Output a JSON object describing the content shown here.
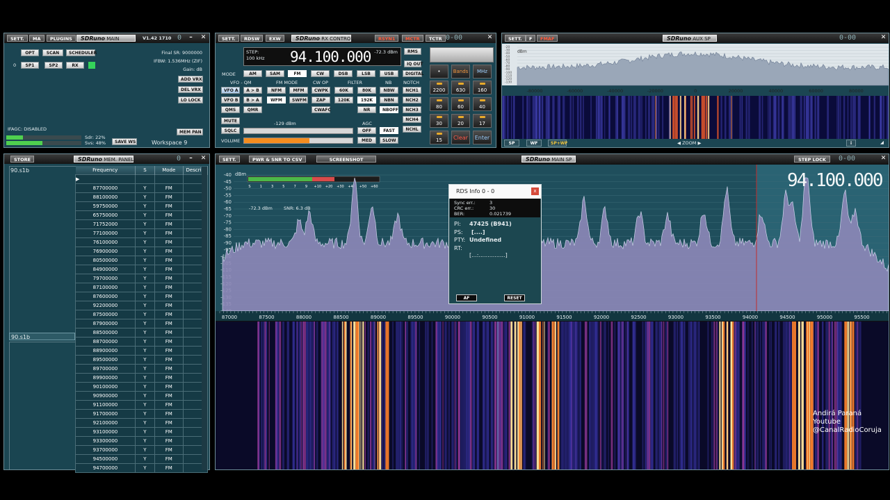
{
  "main_window": {
    "buttons": [
      "SETT.",
      "MA",
      "PLUGINS"
    ],
    "logo": "SDRuno",
    "logo_sub": "MAIN",
    "version": "V1.42 1710",
    "final_sr": "Final SR: 9000000",
    "ifbw": "IFBW: 1.536MHz (ZIF)",
    "gain": "Gain: dB",
    "row1": [
      "OPT",
      "SCAN",
      "SCHEDULER"
    ],
    "row2_index": "0",
    "row2": [
      "SP1",
      "SP2",
      "RX"
    ],
    "side_buttons": [
      "ADD VRX",
      "DEL VRX",
      "LO LOCK"
    ],
    "ifagc": "IFAGC: DISABLED",
    "sdr": "Sdr: 22%",
    "svs": "Svs: 48%",
    "save_ws": "SAVE WS",
    "workspace": "Workspace 9",
    "mem_pan": "MEM PAN",
    "sdr_load": 0.22,
    "svs_load": 0.48
  },
  "rx_control": {
    "buttons_left": [
      "SETT.",
      "RDSW",
      "EXW"
    ],
    "logo": "SDRuno",
    "logo_sub": "RX CONTROL",
    "buttons_right": [
      "RSYN1",
      "MCTR",
      "TCTR"
    ],
    "step_label": "STEP:",
    "step_value": "100 kHz",
    "frequency": "94.100.000",
    "signal_dbm": "-72.3 dBm",
    "rms": "RMS",
    "iq_out": "IQ OUT",
    "digital": "DIGITAL",
    "mode_label": "MODE",
    "modes": [
      "AM",
      "SAM",
      "FM",
      "CW",
      "DSB",
      "LSB",
      "USB"
    ],
    "vfo_label": "VFO - QM",
    "fm_mode_label": "FM MODE",
    "cw_op_label": "CW OP",
    "filter_label": "FILTER",
    "nb_label": "NB",
    "notch_label": "NOTCH",
    "vfo_a": "VFO A",
    "a_to_b": "A > B",
    "vfo_b": "VFO B",
    "b_to_a": "B > A",
    "qms": "QMS",
    "qmr": "QMR",
    "fm_modes": [
      "NFM",
      "MFM",
      "WFM",
      "SWFM"
    ],
    "cw_op": [
      "CWPK",
      "ZAP",
      "CWAFC"
    ],
    "filters": [
      "60K",
      "80K",
      "120K",
      "192K",
      "NR"
    ],
    "nb": [
      "NBW",
      "NBN",
      "NBOFF"
    ],
    "notch": [
      "NCH1",
      "NCH2",
      "NCH3",
      "NCH4",
      "NCHL"
    ],
    "mute": "MUTE",
    "sqlc": "SQLC",
    "volume": "VOLUME",
    "sql_level": "-129 dBm",
    "agc_label": "AGC",
    "agc": [
      "OFF",
      "FAST",
      "MED",
      "SLOW"
    ],
    "volume_level": 0.6,
    "keypad": [
      "•",
      "Bands",
      "MHz",
      "2200",
      "630",
      "160",
      "80",
      "60",
      "40",
      "30",
      "20",
      "17",
      "15",
      "Clear",
      "Enter"
    ]
  },
  "aux_sp": {
    "buttons": [
      "SETT.",
      "F",
      "FMAF"
    ],
    "logo": "SDRuno",
    "logo_sub": "AUX SP",
    "y_labels": [
      "-20",
      "-30",
      "-40",
      "-50",
      "-60",
      "-70",
      "-80",
      "-90",
      "-100",
      "-110",
      "-120",
      "-130"
    ],
    "y_unit": "dBm",
    "x_labels": [
      "-80000",
      "-60000",
      "-40000",
      "-20000",
      "0",
      "20000",
      "40000",
      "60000",
      "80000"
    ],
    "bottom_buttons": [
      "SP",
      "WF",
      "SP+WF"
    ],
    "zoom": "ZOOM",
    "info": "i"
  },
  "memory_panel": {
    "store": "STORE",
    "logo": "SDRuno",
    "logo_sub": "MEM. PANEL",
    "list_item": "90.s1b",
    "list_item_selected": "90.s1b",
    "columns": [
      "Frequency",
      "S",
      "Mode",
      "Descrip"
    ],
    "rows": [
      [
        "87700000",
        "Y",
        "FM"
      ],
      [
        "88100000",
        "Y",
        "FM"
      ],
      [
        "59750000",
        "Y",
        "FM"
      ],
      [
        "65750000",
        "Y",
        "FM"
      ],
      [
        "71752000",
        "Y",
        "FM"
      ],
      [
        "77100000",
        "Y",
        "FM"
      ],
      [
        "76100000",
        "Y",
        "FM"
      ],
      [
        "76900000",
        "Y",
        "FM"
      ],
      [
        "80500000",
        "Y",
        "FM"
      ],
      [
        "84900000",
        "Y",
        "FM"
      ],
      [
        "79700000",
        "Y",
        "FM"
      ],
      [
        "87100000",
        "Y",
        "FM"
      ],
      [
        "87600000",
        "Y",
        "FM"
      ],
      [
        "92200000",
        "Y",
        "FM"
      ],
      [
        "87500000",
        "Y",
        "FM"
      ],
      [
        "87900000",
        "Y",
        "FM"
      ],
      [
        "88500000",
        "Y",
        "FM"
      ],
      [
        "88700000",
        "Y",
        "FM"
      ],
      [
        "88900000",
        "Y",
        "FM"
      ],
      [
        "89500000",
        "Y",
        "FM"
      ],
      [
        "89700000",
        "Y",
        "FM"
      ],
      [
        "89900000",
        "Y",
        "FM"
      ],
      [
        "90100000",
        "Y",
        "FM"
      ],
      [
        "90900000",
        "Y",
        "FM"
      ],
      [
        "91100000",
        "Y",
        "FM"
      ],
      [
        "91700000",
        "Y",
        "FM"
      ],
      [
        "92100000",
        "Y",
        "FM"
      ],
      [
        "93100000",
        "Y",
        "FM"
      ],
      [
        "93300000",
        "Y",
        "FM"
      ],
      [
        "93700000",
        "Y",
        "FM"
      ],
      [
        "94500000",
        "Y",
        "FM"
      ],
      [
        "94700000",
        "Y",
        "FM"
      ]
    ]
  },
  "main_sp": {
    "buttons": [
      "SETT.",
      "PWR & SNR TO CSV",
      "SCREENSHOT"
    ],
    "logo": "SDRuno",
    "logo_sub": "MAIN SP",
    "step_lock": "STEP LOCK",
    "frequency": "94.100.000",
    "y_unit": "dBm",
    "y_labels": [
      "-40",
      "-45",
      "-50",
      "-55",
      "-60",
      "-65",
      "-70",
      "-75",
      "-80",
      "-85",
      "-90",
      "-95",
      "-100",
      "-105",
      "-110",
      "-115",
      "-120",
      "-125",
      "-130",
      "-135",
      "-140"
    ],
    "smeter_labels": [
      "S",
      "1",
      "3",
      "5",
      "7",
      "9",
      "+10",
      "+20",
      "+30",
      "+40",
      "+50",
      "+60"
    ],
    "level": "-72.3 dBm",
    "snr": "SNR: 6.3 dB",
    "x_labels": [
      "87000",
      "87500",
      "88000",
      "88500",
      "89000",
      "89500",
      "90000",
      "90500",
      "91000",
      "91500",
      "92000",
      "92500",
      "93000",
      "93500",
      "94000",
      "94500",
      "95000",
      "95500"
    ]
  },
  "rds_info": {
    "title": "RDS Info 0 - 0",
    "close": "x",
    "sync_err_label": "Sync err.:",
    "sync_err": "3",
    "crc_err_label": "CRC err.:",
    "crc_err": "30",
    "ber_label": "BER:",
    "ber": "0.021739",
    "pi_label": "PI:",
    "pi": "47425 (B941)",
    "ps_label": "PS:",
    "ps": "[....]",
    "pty_label": "PTY:",
    "pty": "Undefined",
    "rt_label": "RT:",
    "rt": "[...:...............]",
    "af": "AF",
    "reset": "RESET"
  },
  "watermark": [
    "Andirá Paraná",
    "Youtube",
    "@CanalRadioCoruja"
  ],
  "colors": {
    "panel": "#1b4552",
    "spectrum": "#8d88b8",
    "waterfall_hot": "#ffe39a",
    "accent_orange": "#f48d1f"
  }
}
